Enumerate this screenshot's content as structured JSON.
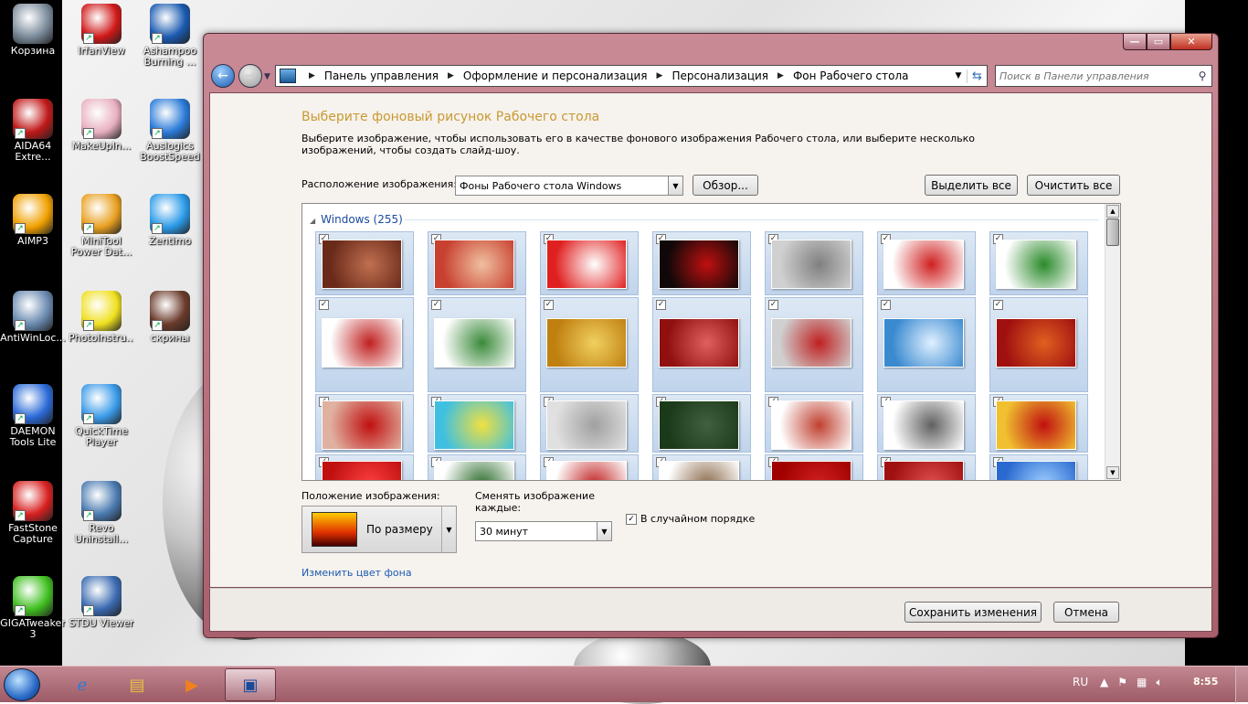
{
  "desktop": {
    "icons": [
      {
        "label": "Корзина",
        "icon": "recycle-bin-icon",
        "color": "#7a8a9a"
      },
      {
        "label": "IrfanView",
        "icon": "irfanview-icon",
        "color": "#d01818"
      },
      {
        "label": "Ashampoo Burning ...",
        "icon": "ashampoo-icon",
        "color": "#1a5ab0"
      },
      {
        "label": "AIDA64 Extre...",
        "icon": "aida64-icon",
        "color": "#c01818"
      },
      {
        "label": "MakeUpIn...",
        "icon": "makeup-icon",
        "color": "#e8b0c0"
      },
      {
        "label": "Auslogics BoostSpeed",
        "icon": "auslogics-icon",
        "color": "#2a7ad8"
      },
      {
        "label": "AIMP3",
        "icon": "aimp-icon",
        "color": "#f0a000"
      },
      {
        "label": "MiniTool Power Dat...",
        "icon": "minitool-icon",
        "color": "#e8a020"
      },
      {
        "label": "Zentimo",
        "icon": "zentimo-icon",
        "color": "#2a9ae8"
      },
      {
        "label": "AntiWinLoc...",
        "icon": "lock-icon",
        "color": "#6a8ab0"
      },
      {
        "label": "PhotoInstru...",
        "icon": "photoinstrument-icon",
        "color": "#f0e020"
      },
      {
        "label": "скрины",
        "icon": "folder-icon",
        "color": "#6a3a2a"
      },
      {
        "label": "DAEMON Tools Lite",
        "icon": "daemon-tools-icon",
        "color": "#2a6ad8"
      },
      {
        "label": "QuickTime Player",
        "icon": "quicktime-icon",
        "color": "#3a9ae8"
      },
      {
        "label": "FastStone Capture",
        "icon": "faststone-icon",
        "color": "#d82020"
      },
      {
        "label": "Revo Uninstall...",
        "icon": "revo-icon",
        "color": "#4a7ab0"
      },
      {
        "label": "GIGATweaker 3",
        "icon": "gigatweaker-icon",
        "color": "#40c020"
      },
      {
        "label": "STDU Viewer",
        "icon": "stdu-icon",
        "color": "#3a6ab0"
      }
    ]
  },
  "window": {
    "breadcrumbs": [
      "Панель управления",
      "Оформление и персонализация",
      "Персонализация",
      "Фон Рабочего стола"
    ],
    "search_placeholder": "Поиск в Панели управления",
    "title": "Выберите фоновый рисунок Рабочего стола",
    "description": "Выберите изображение, чтобы использовать его в качестве фонового изображения Рабочего стола, или выберите несколько изображений, чтобы создать слайд-шоу.",
    "location_label": "Расположение изображения:",
    "location_value": "Фоны Рабочего стола Windows",
    "browse_label": "Обзор...",
    "select_all_label": "Выделить все",
    "clear_all_label": "Очистить все",
    "gallery_group": "Windows (255)",
    "thumbnails": [
      [
        "#6a2a1a",
        "#c07050"
      ],
      [
        "#c84030",
        "#f0c0a0"
      ],
      [
        "#e02020",
        "#ffffff"
      ],
      [
        "#100808",
        "#c01010"
      ],
      [
        "#d0d0d0",
        "#808080"
      ],
      [
        "#ffffff",
        "#d02020"
      ],
      [
        "#ffffff",
        "#2a8a2a"
      ],
      [
        "#ffffff",
        "#c02020"
      ],
      [
        "#ffffff",
        "#3a8a3a"
      ],
      [
        "#c08010",
        "#f0d060"
      ],
      [
        "#901010",
        "#e06060"
      ],
      [
        "#d0d0d0",
        "#c02020"
      ],
      [
        "#3a8ad0",
        "#e0f0ff"
      ],
      [
        "#a01010",
        "#e06020"
      ],
      [
        "#e0b0a0",
        "#c01010"
      ],
      [
        "#40c0e0",
        "#f0e040"
      ],
      [
        "#e0e0e0",
        "#a0a0a0"
      ],
      [
        "#1a3a1a",
        "#406040"
      ],
      [
        "#ffffff",
        "#c04030"
      ],
      [
        "#ffffff",
        "#606060"
      ],
      [
        "#f0c030",
        "#c01010"
      ],
      [
        "#c01010",
        "#ff4040"
      ],
      [
        "#ffffff",
        "#2a6a2a"
      ],
      [
        "#ffffff",
        "#c02020"
      ],
      [
        "#ffffff",
        "#8a6a4a"
      ],
      [
        "#a00000",
        "#d02020"
      ],
      [
        "#a01010",
        "#e05050"
      ],
      [
        "#2a6ad0",
        "#a0d0ff"
      ]
    ],
    "position_label": "Положение изображения:",
    "position_value": "По размеру",
    "interval_label": "Сменять изображение каждые:",
    "interval_value": "30 минут",
    "shuffle_label": "В случайном порядке",
    "shuffle_checked": true,
    "bgcolor_link": "Изменить цвет фона",
    "save_label": "Сохранить изменения",
    "cancel_label": "Отмена"
  },
  "taskbar": {
    "language": "RU",
    "clock": "8:55"
  }
}
